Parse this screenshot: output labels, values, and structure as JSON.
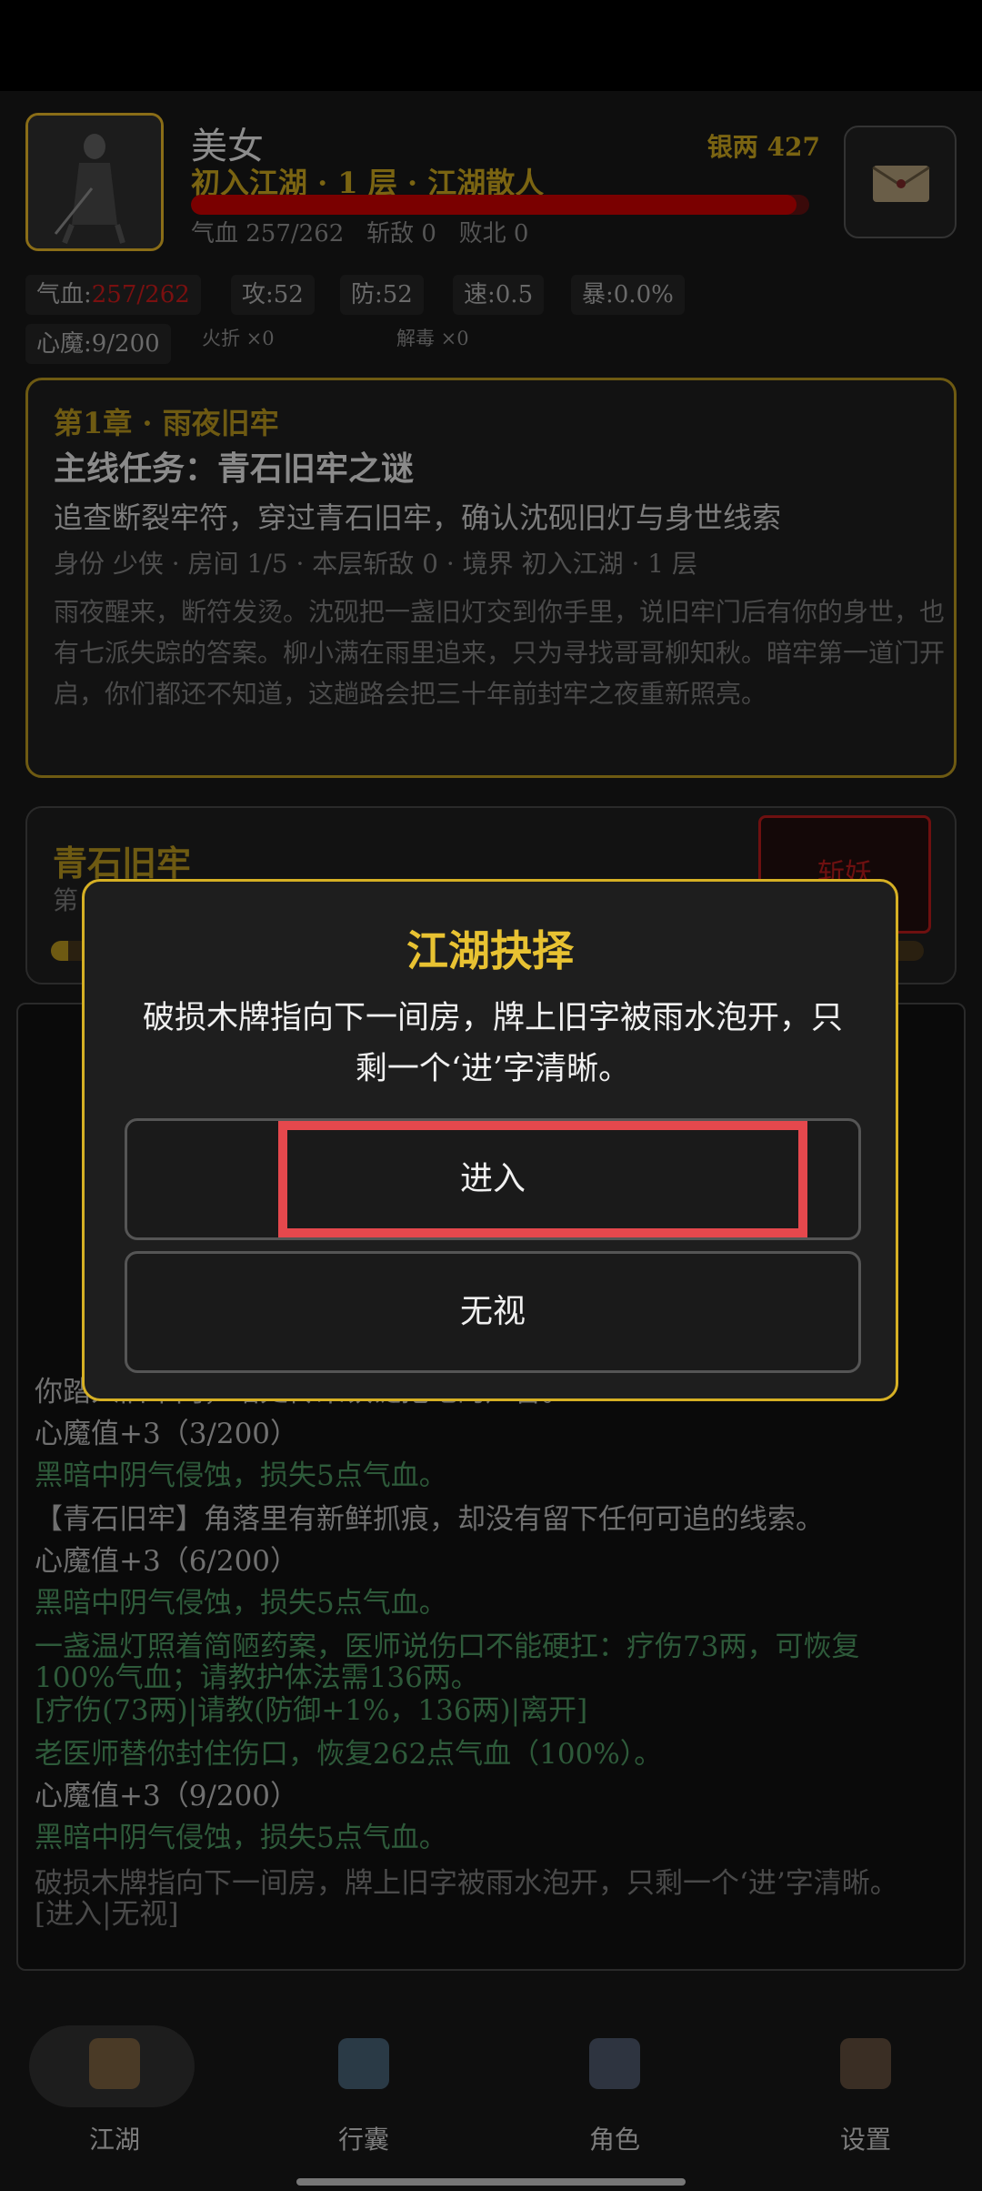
{
  "player": {
    "name": "美女",
    "rank": "初入江湖 · 1 层 · 江湖散人",
    "silver": "银两 427",
    "hp_fraction": 0.98,
    "hp_line": "气血 257/262   斩敌 0   败北 0"
  },
  "stats": {
    "hp_label": "气血:",
    "hp_value": "257/262",
    "atk": "攻:52",
    "def": "防:52",
    "spd": "速:0.5",
    "crit": "暴:0.0%",
    "demon": "心魔:9/200",
    "item1": "火折 ×0",
    "item2": "解毒 ×0"
  },
  "quest": {
    "chapter": "第1章 · 雨夜旧牢",
    "title": "主线任务：青石旧牢之谜",
    "goal": "追查断裂牢符，穿过青石旧牢，确认沈砚旧灯与身世线索",
    "meta": "身份 少侠 · 房间 1/5 · 本层斩敌 0 · 境界 初入江湖 · 1 层",
    "desc": "雨夜醒来，断符发烫。沈砚把一盏旧灯交到你手里，说旧牢门后有你的身世，也有七派失踪的答案。柳小满在雨里追来，只为寻找哥哥柳知秋。暗牢第一道门开启，你们都还不知道，这趟路会把三十年前封牢之夜重新照亮。"
  },
  "room": {
    "name": "青石旧牢",
    "sub": "第",
    "progress": 0.02,
    "kill_label": "斩妖"
  },
  "log": [
    {
      "text": "你踏入旧牢门，暗处传来铁链拖地的声音。",
      "style": "white"
    },
    {
      "text": "心魔值+3（3/200）",
      "style": "white"
    },
    {
      "text": "黑暗中阴气侵蚀，损失5点气血。",
      "style": "green"
    },
    {
      "text": "【青石旧牢】角落里有新鲜抓痕，却没有留下任何可追的线索。",
      "style": "white"
    },
    {
      "text": "心魔值+3（6/200）",
      "style": "white"
    },
    {
      "text": "黑暗中阴气侵蚀，损失5点气血。",
      "style": "green"
    },
    {
      "text": "一盏温灯照着简陋药案，医师说伤口不能硬扛：疗伤73两，可恢复",
      "style": "green"
    },
    {
      "text": "100%气血；请教护体法需136两。",
      "style": "green"
    },
    {
      "text": "[疗伤(73两)|请教(防御+1%，136两)|离开]",
      "style": "green"
    },
    {
      "text": "老医师替你封住伤口，恢复262点气血（100%）。",
      "style": "green"
    },
    {
      "text": "心魔值+3（9/200）",
      "style": "white"
    },
    {
      "text": "黑暗中阴气侵蚀，损失5点气血。",
      "style": "green"
    },
    {
      "text": "破损木牌指向下一间房，牌上旧字被雨水泡开，只剩一个‘进’字清晰。",
      "style": "grey"
    },
    {
      "text": "[进入|无视]",
      "style": "grey"
    }
  ],
  "modal": {
    "title": "江湖抉择",
    "text": "破损木牌指向下一间房，牌上旧字被雨水泡开，只剩一个‘进’字清晰。",
    "enter_label": "进入",
    "ignore_label": "无视"
  },
  "nav": [
    {
      "label": "江湖",
      "icon": "jianghu-icon",
      "active": true
    },
    {
      "label": "行囊",
      "icon": "bag-icon",
      "active": false
    },
    {
      "label": "角色",
      "icon": "character-icon",
      "active": false
    },
    {
      "label": "设置",
      "icon": "settings-icon",
      "active": false
    }
  ],
  "colors": {
    "accent_gold": "#e8c232",
    "modal_border": "#d6b024",
    "highlight": "#e5484d"
  }
}
